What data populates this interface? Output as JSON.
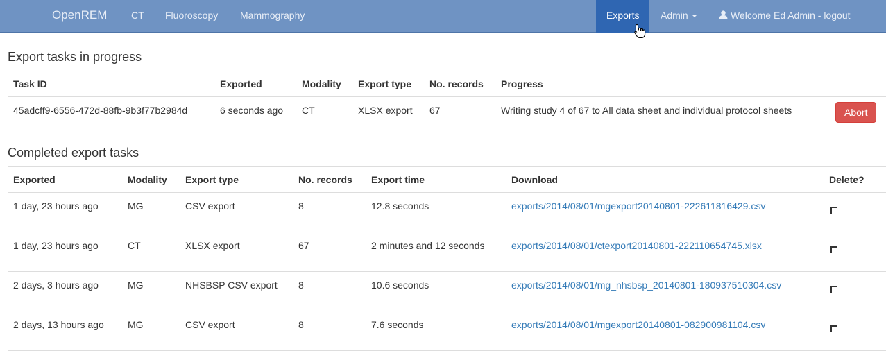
{
  "navbar": {
    "brand": "OpenREM",
    "items": [
      "CT",
      "Fluoroscopy",
      "Mammography"
    ],
    "exports": "Exports",
    "admin": "Admin",
    "user": "Welcome Ed Admin - logout"
  },
  "in_progress": {
    "heading": "Export tasks in progress",
    "columns": [
      "Task ID",
      "Exported",
      "Modality",
      "Export type",
      "No. records",
      "Progress"
    ],
    "row": {
      "task_id": "45adcff9-6556-472d-88fb-9b3f77b2984d",
      "exported": "6 seconds ago",
      "modality": "CT",
      "export_type": "XLSX export",
      "records": "67",
      "progress": "Writing study 4 of 67 to All data sheet and individual protocol sheets",
      "abort": "Abort"
    }
  },
  "completed": {
    "heading": "Completed export tasks",
    "columns": [
      "Exported",
      "Modality",
      "Export type",
      "No. records",
      "Export time",
      "Download",
      "Delete?"
    ],
    "rows": [
      {
        "exported": "1 day, 23 hours ago",
        "modality": "MG",
        "export_type": "CSV export",
        "records": "8",
        "time": "12.8 seconds",
        "download": "exports/2014/08/01/mgexport20140801-222611816429.csv"
      },
      {
        "exported": "1 day, 23 hours ago",
        "modality": "CT",
        "export_type": "XLSX export",
        "records": "67",
        "time": "2 minutes and 12 seconds",
        "download": "exports/2014/08/01/ctexport20140801-222110654745.xlsx"
      },
      {
        "exported": "2 days, 3 hours ago",
        "modality": "MG",
        "export_type": "NHSBSP CSV export",
        "records": "8",
        "time": "10.6 seconds",
        "download": "exports/2014/08/01/mg_nhsbsp_20140801-180937510304.csv"
      },
      {
        "exported": "2 days, 13 hours ago",
        "modality": "MG",
        "export_type": "CSV export",
        "records": "8",
        "time": "7.6 seconds",
        "download": "exports/2014/08/01/mgexport20140801-082900981104.csv"
      }
    ]
  },
  "colors": {
    "navbar": "#6f93c3",
    "active_nav": "#2f66b2",
    "abort": "#d9534f",
    "link": "#337ab7"
  },
  "icons": [
    "user-icon",
    "caret-down-icon",
    "hand-cursor-icon",
    "checkbox-icon"
  ]
}
